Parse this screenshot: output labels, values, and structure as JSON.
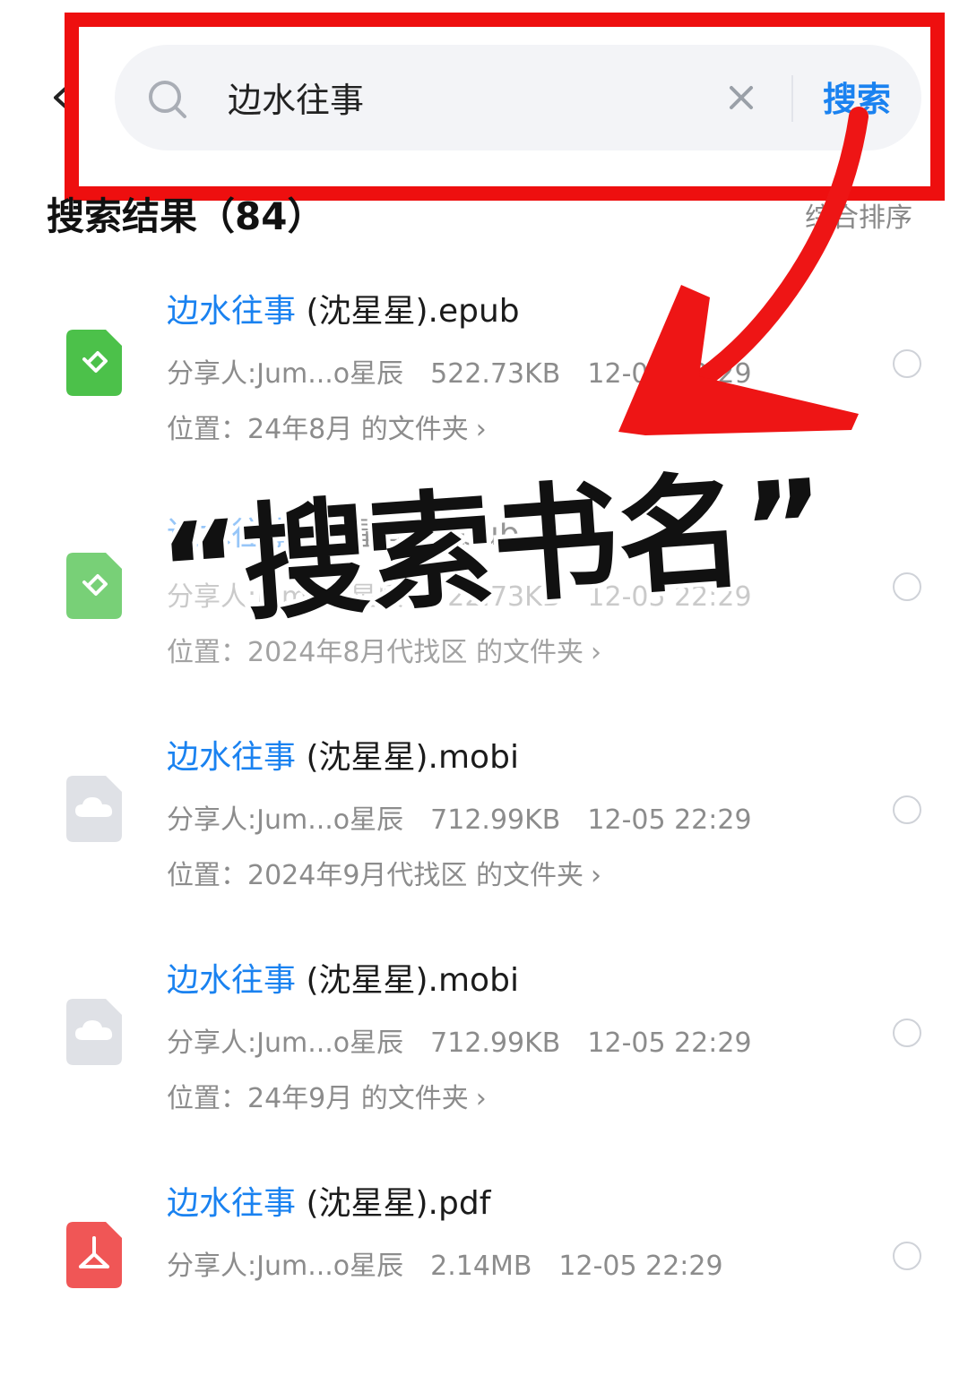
{
  "search": {
    "query": "边水往事",
    "button_label": "搜索"
  },
  "results": {
    "title": "搜索结果（84）",
    "sort_label": "综合排序",
    "items": [
      {
        "name_highlight": "边水往事",
        "name_rest": " (沈星星).epub",
        "sharer": "分享人:Jum...o星辰",
        "size": "522.73KB",
        "date": "12-05 22:29",
        "location": "位置：24年8月 的文件夹",
        "icon": "epub-icon"
      },
      {
        "name_highlight": "边水往事",
        "name_rest": " (沈星星).epub",
        "sharer": "分享人:Jum...o星辰",
        "size": "522.73KB",
        "date": "12-05 22:29",
        "location": "位置：2024年8月代找区 的文件夹",
        "icon": "epub-icon"
      },
      {
        "name_highlight": "边水往事",
        "name_rest": " (沈星星).mobi",
        "sharer": "分享人:Jum...o星辰",
        "size": "712.99KB",
        "date": "12-05 22:29",
        "location": "位置：2024年9月代找区 的文件夹",
        "icon": "cloud-file-icon"
      },
      {
        "name_highlight": "边水往事",
        "name_rest": " (沈星星).mobi",
        "sharer": "分享人:Jum...o星辰",
        "size": "712.99KB",
        "date": "12-05 22:29",
        "location": "位置：24年9月 的文件夹",
        "icon": "cloud-file-icon"
      },
      {
        "name_highlight": "边水往事",
        "name_rest": " (沈星星).pdf",
        "sharer": "分享人:Jum...o星辰",
        "size": "2.14MB",
        "date": "12-05 22:29",
        "location": "",
        "icon": "pdf-icon"
      }
    ]
  },
  "overlay": {
    "caption": "“搜索书名”"
  },
  "colors": {
    "accent": "#1a82f0",
    "highlight_red": "#ee0f0f",
    "epub_green": "#4cc14a",
    "pdf_red": "#f05656",
    "cloud_gray": "#dfe1e6"
  }
}
